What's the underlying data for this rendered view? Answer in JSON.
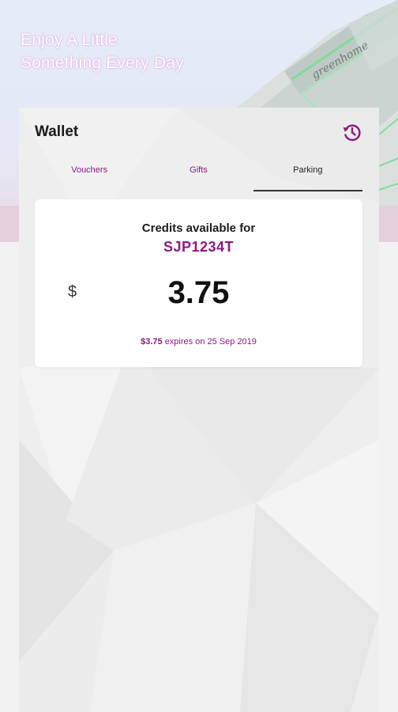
{
  "banner": {
    "tagline_line1": "Enjoy A Little",
    "tagline_line2": "Something Every Day",
    "building_sign": "greenhome"
  },
  "wallet": {
    "title": "Wallet",
    "history_icon": "history-icon",
    "tabs": [
      {
        "label": "Vouchers",
        "active": false
      },
      {
        "label": "Gifts",
        "active": false
      },
      {
        "label": "Parking",
        "active": true
      }
    ]
  },
  "credits_card": {
    "heading": "Credits available for",
    "vehicle_plate": "SJP1234T",
    "currency_symbol": "$",
    "amount": "3.75",
    "expiry_amount": "$3.75",
    "expiry_text": "expires on 25 Sep 2019"
  },
  "colors": {
    "accent": "#8a1a82",
    "text_dark": "#1a1a1a",
    "card_bg": "#ffffff",
    "panel_bg": "#eeeeee"
  }
}
